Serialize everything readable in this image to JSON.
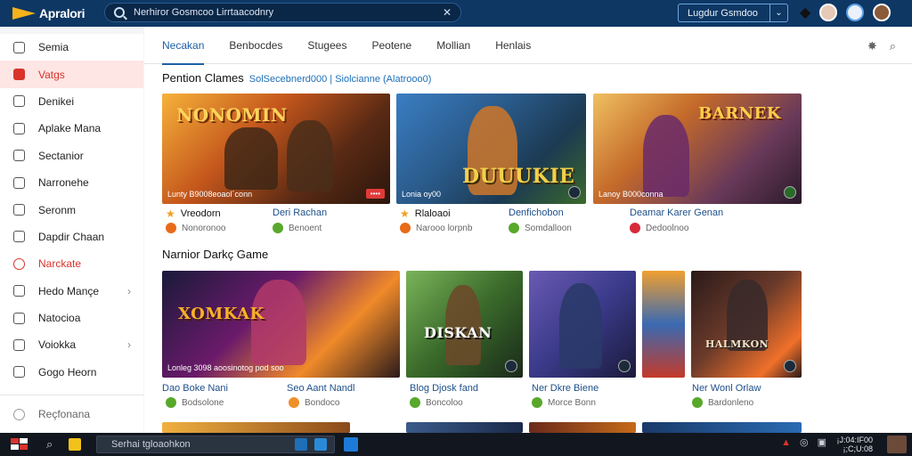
{
  "app": {
    "logo_text": "Apralori"
  },
  "search": {
    "value": "Nerhiror Gosmcoo Lirrtaacodnry",
    "placeholder": "Search"
  },
  "top_button": {
    "label": "Lugdur Gsmdoo"
  },
  "sidebar": {
    "items": [
      {
        "label": "Semia",
        "icon": "home-icon"
      },
      {
        "label": "Vatgs",
        "icon": "games-icon",
        "active": true
      },
      {
        "label": "Denikei",
        "icon": "library-icon"
      },
      {
        "label": "Aplake Mana",
        "icon": "apps-icon"
      },
      {
        "label": "Sectanior",
        "icon": "section-icon"
      },
      {
        "label": "Narronehe",
        "icon": "news-icon"
      },
      {
        "label": "Seronm",
        "icon": "globe-icon"
      },
      {
        "label": "Dapdir Chaan",
        "icon": "channel-icon"
      },
      {
        "label": "Narckate",
        "icon": "clock-icon",
        "red": true
      },
      {
        "label": "Hedo Mançe",
        "icon": "folder-icon",
        "arrow": true
      },
      {
        "label": "Natocioa",
        "icon": "calendar-icon"
      },
      {
        "label": "Voiokka",
        "icon": "grid-icon",
        "arrow": true
      },
      {
        "label": "Gogo Heorn",
        "icon": "location-icon"
      }
    ],
    "footer": {
      "label": "Reçfonana",
      "icon": "settings-icon"
    }
  },
  "tabs": [
    {
      "label": "Necakan",
      "active": true
    },
    {
      "label": "Benbocdes"
    },
    {
      "label": "Stugees"
    },
    {
      "label": "Peotene"
    },
    {
      "label": "Mollian"
    },
    {
      "label": "Henlais"
    }
  ],
  "section1": {
    "title": "Pention Clames",
    "subtitle": "SolSecebnerd000  |  Siolcianne (Alatrooo0)",
    "cards": [
      {
        "art_title": "NONOMIN",
        "overlay": "Lunty B9008eoaol´conn",
        "badge": "••••",
        "pub": "Vreodorn",
        "name": "Deri Rachan",
        "sub1": "Nonoronoo",
        "sub2": "Benoent"
      },
      {
        "art_title": "DUUUKIE",
        "overlay": "Lonia oy00",
        "pub": "Rlaloaoi",
        "name": "Denfichobon",
        "sub1": "Narooo lorpnb",
        "sub2": "Somdalloon"
      },
      {
        "art_title": "BARNEK",
        "overlay": "Lanoy B000conna",
        "pub": "",
        "name": "Deamar Karer Genan",
        "sub1": "",
        "sub2": "Dedoolnoo"
      }
    ]
  },
  "section2": {
    "title": "Narnior Darkç Game",
    "cards": [
      {
        "art_title": "XOMKAK",
        "overlay": "Lonleg 3098 aoosinotog pod soo",
        "name": "Dao Boke Nani",
        "sub": "Bodsolone"
      },
      {
        "art_title": "DISKAN",
        "overlay": "",
        "name": "Seo Aant Nandl",
        "sub": "Bondoco"
      },
      {
        "art_title": "",
        "overlay": "",
        "name": "Blog Djosk fand",
        "sub": "Boncoloo"
      },
      {
        "art_title": "",
        "overlay": "",
        "name": "Ner Dkre Biene",
        "sub": "Morce Bonn"
      },
      {
        "art_title": "HALMKON",
        "overlay": "",
        "name": "Ner Wonl Orlaw",
        "sub": "Bardonleno"
      }
    ]
  },
  "taskbar": {
    "search_text": "Serhai tgloaohkon",
    "clock_time": "¡J:04:IF00",
    "clock_date": "¡;C;U:08"
  },
  "colors": {
    "topbar": "#0e3764",
    "accent": "#1d5fa6",
    "active_nav": "#d9332b"
  }
}
